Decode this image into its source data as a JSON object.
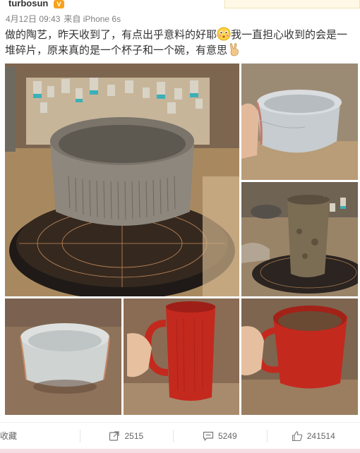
{
  "post": {
    "username": "turbosun",
    "vip_badge": "V",
    "date": "4月12日 09:43",
    "source": "来自 iPhone 6s",
    "text_part1": "做的陶艺，昨天收到了，有点出乎意料的好耶",
    "text_part2": "我一直担心收到的会是一堆碎片，原来真的是一个杯子和一个碗，有意思",
    "emoji1": "blushing-face-icon",
    "emoji2": "victory-hand-icon"
  },
  "photos": [
    {
      "subject": "grey-clay-bowl-on-wheel"
    },
    {
      "subject": "glazed-white-bowl-in-hand"
    },
    {
      "subject": "unfired-clay-cup-on-wheel"
    },
    {
      "subject": "glazed-white-bowl"
    },
    {
      "subject": "red-glazed-mug-side"
    },
    {
      "subject": "red-glazed-mug-inside"
    }
  ],
  "actions": {
    "favorite_label": "收藏",
    "repost_count": "2515",
    "comment_count": "5249",
    "like_count": "241514"
  },
  "colors": {
    "clay_grey": "#8c877d",
    "glaze_white": "#c9cfd3",
    "glaze_red": "#c4291e",
    "wood": "#a07a55",
    "wheel": "#2e2622"
  }
}
